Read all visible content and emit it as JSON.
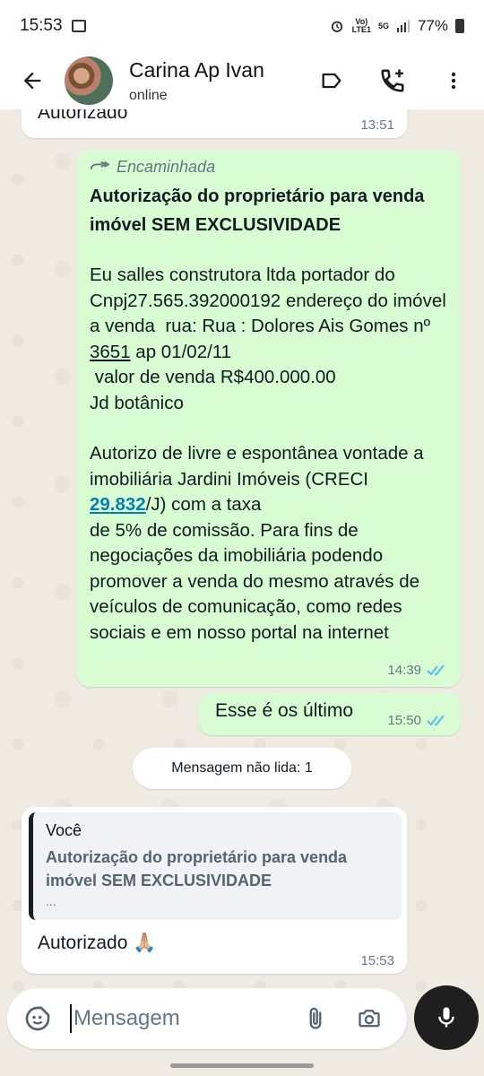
{
  "status_bar": {
    "time": "15:53",
    "battery": "77%",
    "volte": "Vo)\nLTE1",
    "network": "5G"
  },
  "header": {
    "contact_name": "Carina Ap Ivan",
    "contact_status": "online"
  },
  "messages": {
    "first": {
      "text": "Autorizado",
      "time": "13:51"
    },
    "forwarded": {
      "forward_label": "Encaminhada",
      "title": "Autorização do proprietário para venda imóvel SEM EXCLUSIVIDADE",
      "p1_a": "Eu salles construtora ltda portador do Cnpj27.565.392000192 endereço do imóvel a venda  rua: Rua : Dolores Ais Gomes nº ",
      "p1_link": "3651",
      "p1_b": " ap 01/02/11\n valor de venda R$400.000.00\nJd botânico",
      "p2_a": "Autorizo de livre e espontânea vontade a imobiliária Jardini Imóveis (CRECI ",
      "p2_link": "29.832",
      "p2_b": "/J) com a taxa\nde 5% de comissão. Para fins de negociações da imobiliária podendo promover a venda do mesmo através de veículos de comunicação, como redes sociais e em nosso portal na internet",
      "time": "14:39"
    },
    "last_sent": {
      "text": "Esse é os último",
      "time": "15:50"
    },
    "unread_label": "Mensagem não lida: 1",
    "reply": {
      "quote_author": "Você",
      "quote_text": "Autorização do proprietário para venda imóvel SEM EXCLUSIVIDADE",
      "quote_more": "...",
      "text": "Autorizado 🙏🏼",
      "time": "15:53"
    }
  },
  "composer": {
    "placeholder": "Mensagem"
  },
  "colors": {
    "outgoing_bubble": "#d9fdd3",
    "incoming_bubble": "#ffffff",
    "read_ticks": "#53bdeb",
    "link": "#027eb5",
    "chat_background": "#efeae2"
  },
  "icons": [
    "back-arrow-icon",
    "label-icon",
    "add-call-icon",
    "more-vert-icon",
    "forward-icon",
    "double-check-icon",
    "sticker-icon",
    "attach-icon",
    "camera-icon",
    "mic-icon"
  ]
}
